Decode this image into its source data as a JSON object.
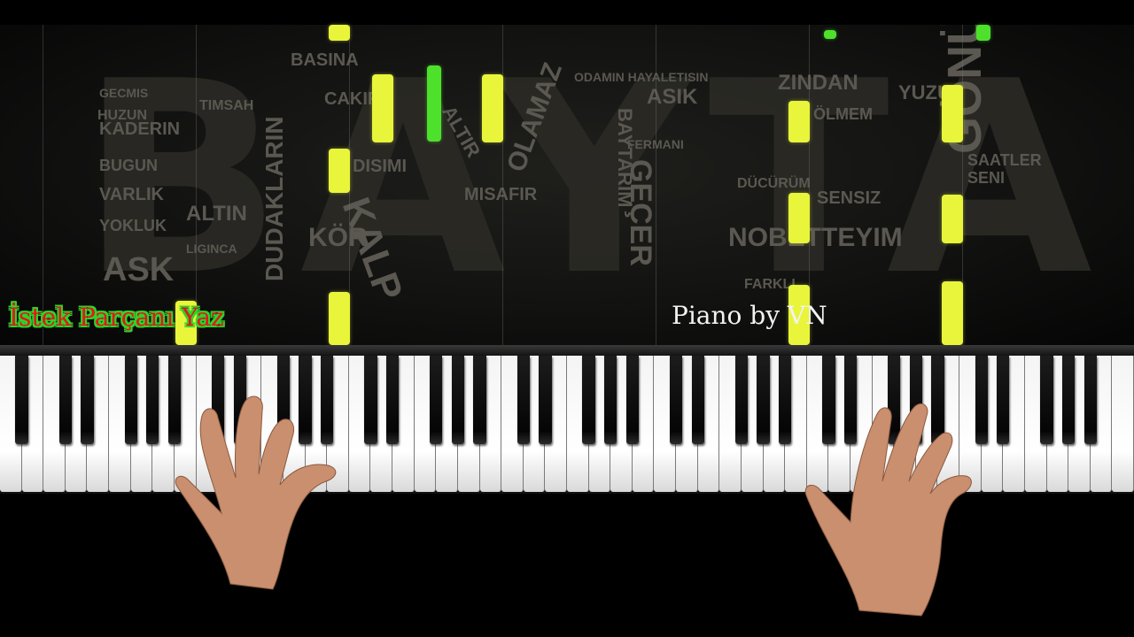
{
  "overlay": {
    "request_text": "İstek Parçanı Yaz",
    "credit_text": "Piano by VN"
  },
  "backdrop": {
    "big_title": "BAYTAR",
    "words": [
      "BASINA",
      "GECMIS",
      "HUZUN",
      "KADERIN",
      "BUGUN",
      "VARLIK",
      "YOKLUK",
      "ASK",
      "TIMSAH",
      "ALTIN",
      "LIGINCA",
      "DUDAKLARIN",
      "KALP",
      "KÖR",
      "DISIMI",
      "CAKIR",
      "ALTIR",
      "OLAMAZ",
      "MISAFIR",
      "GEÇER",
      "BAYTARIM",
      "ODAMIN HAYALETISIN",
      "ASIK",
      "ZINDAN",
      "NOBETTEYIM",
      "SENSIZ",
      "DÜCÜRÜM",
      "GÖNÜL",
      "YUZU",
      "SAATLER",
      "SENI",
      "FARKLI",
      "FERMANI",
      "ÖLMEM"
    ]
  },
  "colors": {
    "note_yellow": "#e8f53a",
    "note_green": "#4ee12c",
    "request_text": "#e3171b",
    "request_outline": "#2fd32a"
  }
}
